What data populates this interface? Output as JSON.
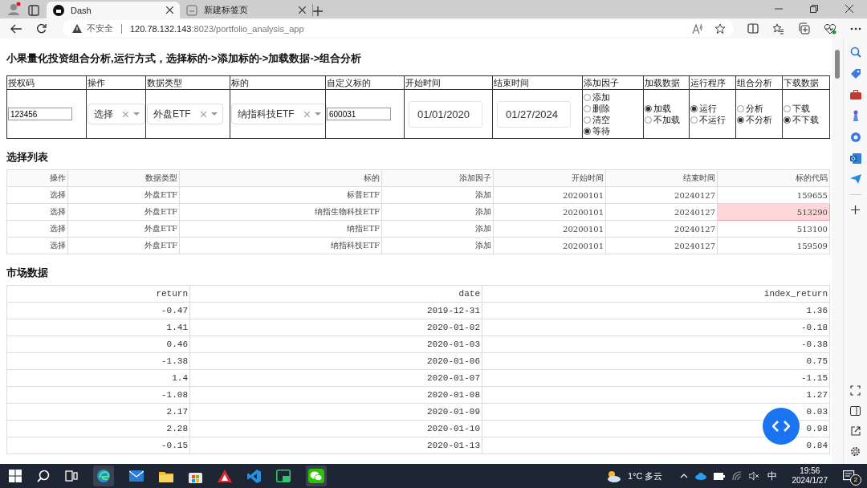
{
  "browser": {
    "tabs": [
      {
        "title": "Dash",
        "selected": true
      },
      {
        "title": "新建标签页",
        "selected": false
      }
    ],
    "address": {
      "security": "不安全",
      "host": "120.78.132.143",
      "path": ":8023/portfolio_analysis_app"
    }
  },
  "page": {
    "title": "小果量化投资组合分析,运行方式，选择标的->添加标的->加载数据->组合分析",
    "form": [
      {
        "label": "授权码",
        "kind": "input",
        "value": "123456"
      },
      {
        "label": "操作",
        "kind": "dropdown",
        "value": "选择"
      },
      {
        "label": "数据类型",
        "kind": "dropdown",
        "value": "外盘ETF"
      },
      {
        "label": "标的",
        "kind": "dropdown",
        "value": "纳指科技ETF"
      },
      {
        "label": "自定义标的",
        "kind": "input",
        "value": "600031"
      },
      {
        "label": "开始时间",
        "kind": "date",
        "value": "01/01/2020"
      },
      {
        "label": "结束时间",
        "kind": "date",
        "value": "01/27/2024"
      },
      {
        "label": "添加因子",
        "kind": "radio",
        "options": [
          {
            "label": "添加",
            "selected": false
          },
          {
            "label": "删除",
            "selected": false
          },
          {
            "label": "清空",
            "selected": false
          },
          {
            "label": "等待",
            "selected": true
          }
        ]
      },
      {
        "label": "加载数据",
        "kind": "radio",
        "options": [
          {
            "label": "加载",
            "selected": true
          },
          {
            "label": "不加载",
            "selected": false
          }
        ]
      },
      {
        "label": "运行程序",
        "kind": "radio",
        "options": [
          {
            "label": "运行",
            "selected": true
          },
          {
            "label": "不运行",
            "selected": false
          }
        ]
      },
      {
        "label": "组合分析",
        "kind": "radio",
        "options": [
          {
            "label": "分析",
            "selected": false
          },
          {
            "label": "不分析",
            "selected": true
          }
        ]
      },
      {
        "label": "下载数据",
        "kind": "radio",
        "options": [
          {
            "label": "下载",
            "selected": false
          },
          {
            "label": "不下载",
            "selected": true
          }
        ]
      }
    ],
    "selection_title": "选择列表",
    "selection_table": {
      "columns": [
        "操作",
        "数据类型",
        "标的",
        "添加因子",
        "开始时间",
        "结束时间",
        "标的代码"
      ],
      "rows": [
        {
          "cells": [
            {
              "text": "选择",
              "selected": false
            },
            {
              "text": "外盘ETF",
              "selected": false
            },
            {
              "text": "标普ETF",
              "selected": false
            },
            {
              "text": "添加",
              "selected": false
            },
            {
              "text": "20200101",
              "selected": false
            },
            {
              "text": "20240127",
              "selected": false
            },
            {
              "text": "159655",
              "selected": false
            }
          ]
        },
        {
          "cells": [
            {
              "text": "选择",
              "selected": false
            },
            {
              "text": "外盘ETF",
              "selected": false
            },
            {
              "text": "纳指生物科技ETF",
              "selected": false
            },
            {
              "text": "添加",
              "selected": false
            },
            {
              "text": "20200101",
              "selected": false
            },
            {
              "text": "20240127",
              "selected": false
            },
            {
              "text": "513290",
              "selected": true
            }
          ]
        },
        {
          "cells": [
            {
              "text": "选择",
              "selected": false
            },
            {
              "text": "外盘ETF",
              "selected": false
            },
            {
              "text": "纳指ETF",
              "selected": false
            },
            {
              "text": "添加",
              "selected": false
            },
            {
              "text": "20200101",
              "selected": false
            },
            {
              "text": "20240127",
              "selected": false
            },
            {
              "text": "513100",
              "selected": false
            }
          ]
        },
        {
          "cells": [
            {
              "text": "选择",
              "selected": false
            },
            {
              "text": "外盘ETF",
              "selected": false
            },
            {
              "text": "纳指科技ETF",
              "selected": false
            },
            {
              "text": "添加",
              "selected": false
            },
            {
              "text": "20200101",
              "selected": false
            },
            {
              "text": "20240127",
              "selected": false
            },
            {
              "text": "159509",
              "selected": false
            }
          ]
        }
      ]
    },
    "market_title": "市场数据",
    "market_table": {
      "columns": [
        "return",
        "date",
        "index_return"
      ],
      "rows": [
        [
          "-0.47",
          "2019-12-31",
          "1.36"
        ],
        [
          "1.41",
          "2020-01-02",
          "-0.18"
        ],
        [
          "0.46",
          "2020-01-03",
          "-0.38"
        ],
        [
          "-1.38",
          "2020-01-06",
          "0.75"
        ],
        [
          "1.4",
          "2020-01-07",
          "-1.15"
        ],
        [
          "-1.08",
          "2020-01-08",
          "1.27"
        ],
        [
          "2.17",
          "2020-01-09",
          "0.03"
        ],
        [
          "2.28",
          "2020-01-10",
          "0.98"
        ],
        [
          "-0.15",
          "2020-01-13",
          "0.84"
        ]
      ]
    }
  },
  "taskbar": {
    "weather_temp": "1°C",
    "weather_text": "多云",
    "ime": "中",
    "time": "19:56",
    "date": "2024/1/27",
    "notifications": "2"
  }
}
